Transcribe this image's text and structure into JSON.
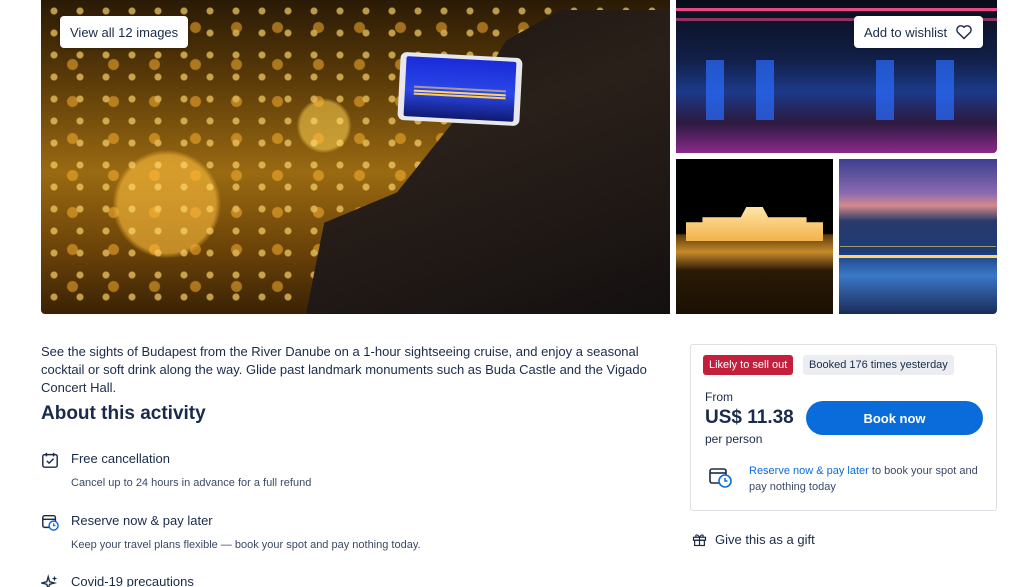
{
  "gallery": {
    "view_all_label": "View all 12 images",
    "wishlist_label": "Add to wishlist"
  },
  "description": "See the sights of Budapest from the River Danube on a 1-hour sightseeing cruise, and enjoy a seasonal cocktail or soft drink along the way. Glide past landmark monuments such as Buda Castle and the Vigado Concert Hall.",
  "about": {
    "title": "About this activity",
    "features": [
      {
        "icon": "calendar-check-icon",
        "title": "Free cancellation",
        "desc": "Cancel up to 24 hours in advance for a full refund"
      },
      {
        "icon": "calendar-clock-icon",
        "title": "Reserve now & pay later",
        "desc": "Keep your travel plans flexible — book your spot and pay nothing today."
      },
      {
        "icon": "sparkle-icon",
        "title": "Covid-19 precautions",
        "desc": ""
      }
    ]
  },
  "booking": {
    "badge_urgent": "Likely to sell out",
    "badge_booked": "Booked 176 times yesterday",
    "from_label": "From",
    "price": "US$ 11.38",
    "per_label": "per person",
    "book_button": "Book now",
    "reserve_link": "Reserve now & pay later",
    "reserve_rest": " to book your spot and pay nothing today"
  },
  "gift_label": "Give this as a gift",
  "colors": {
    "primary": "#0a6cdb",
    "urgent": "#c41f3c",
    "text": "#1a2b49"
  }
}
